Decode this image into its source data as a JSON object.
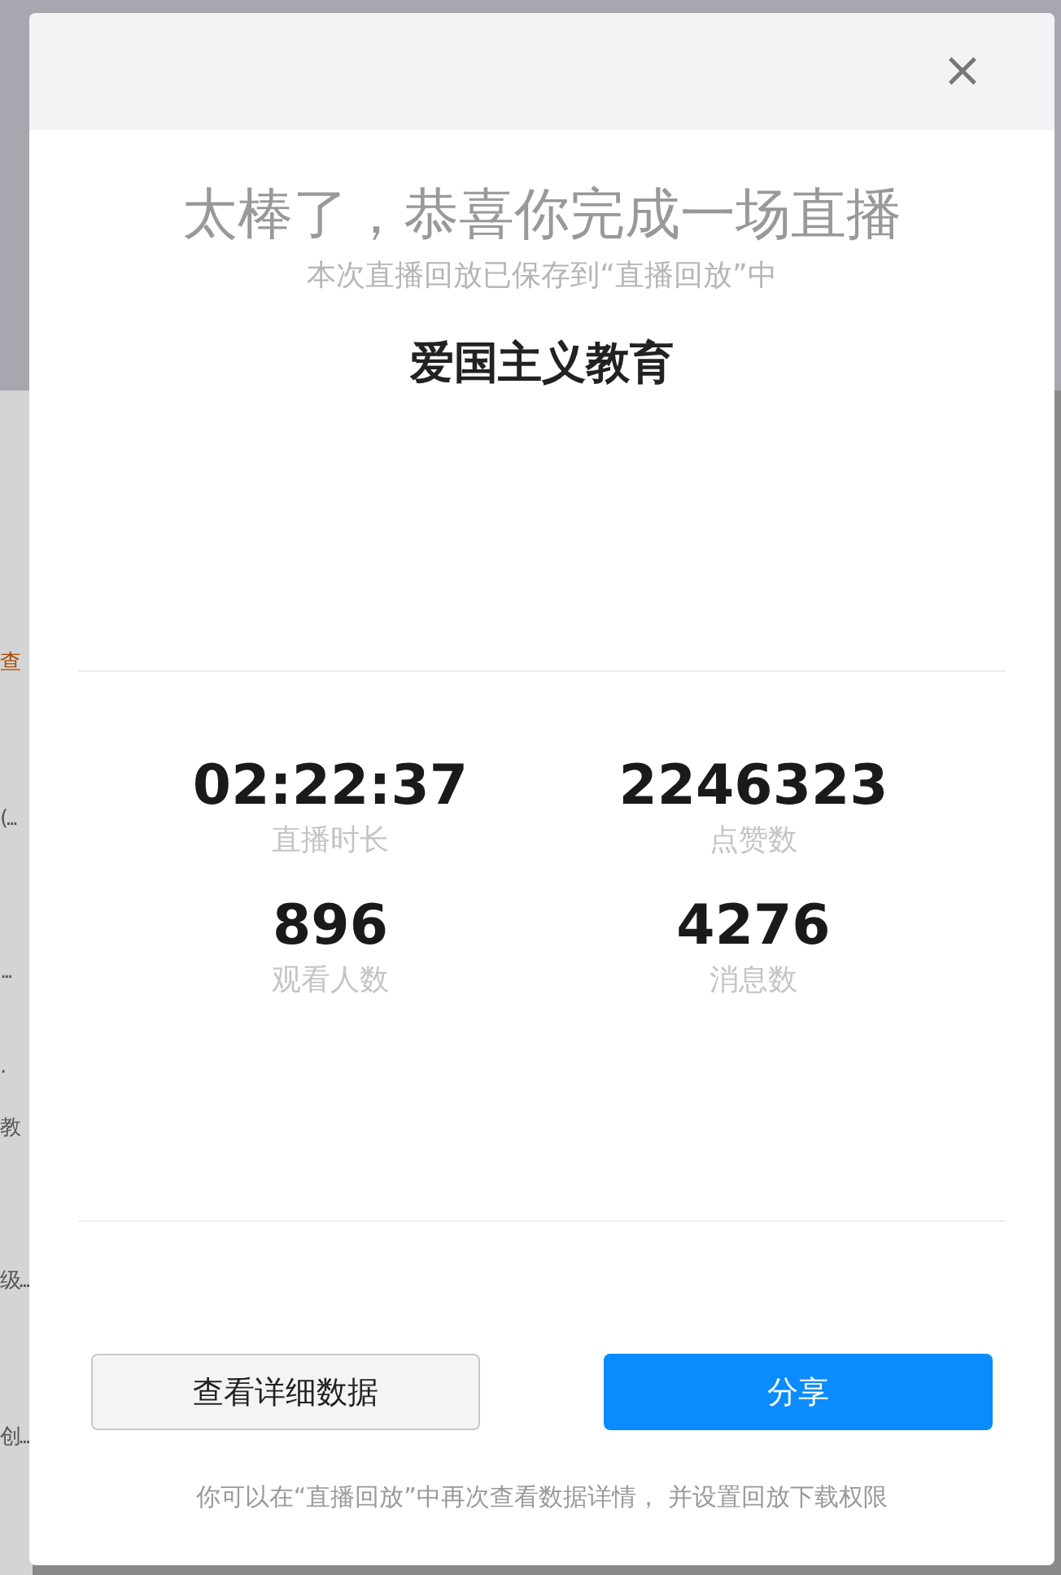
{
  "background": {
    "items": [
      {
        "text": "查",
        "color": "#a84a00"
      },
      {
        "text": "(...",
        "color": "#555555"
      },
      {
        "text": "...",
        "color": "#555555"
      },
      {
        "text": "·",
        "color": "#555555"
      },
      {
        "text": "教",
        "color": "#555555"
      },
      {
        "text": "级...",
        "color": "#555555"
      },
      {
        "text": "创...",
        "color": "#555555"
      }
    ]
  },
  "dialog": {
    "close": "×",
    "title": "太棒了，恭喜你完成一场直播",
    "subtitle": "本次直播回放已保存到“直播回放”中",
    "live_name": "爱国主义教育",
    "stats": [
      {
        "value": "02:22:37",
        "label": "直播时长"
      },
      {
        "value": "2246323",
        "label": "点赞数"
      },
      {
        "value": "896",
        "label": "观看人数"
      },
      {
        "value": "4276",
        "label": "消息数"
      }
    ],
    "buttons": [
      {
        "label": "查看详细数据",
        "kind": "secondary"
      },
      {
        "label": "分享",
        "kind": "primary"
      }
    ],
    "footer": "你可以在“直播回放”中再次查看数据详情， 并设置回放下载权限"
  }
}
